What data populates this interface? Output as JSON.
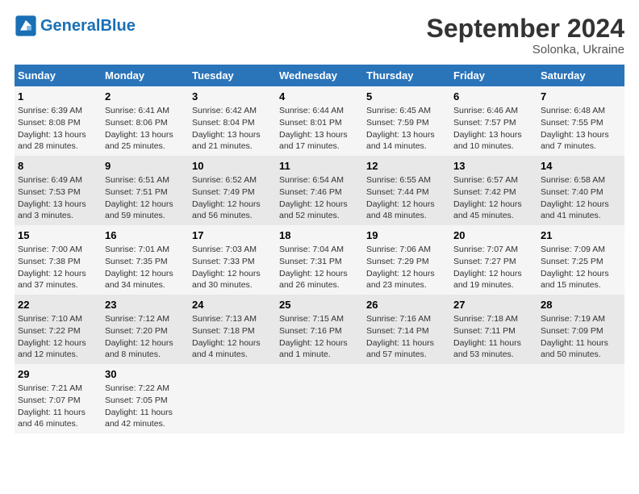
{
  "header": {
    "logo_line1": "General",
    "logo_line2": "Blue",
    "month": "September 2024",
    "location": "Solonka, Ukraine"
  },
  "days_of_week": [
    "Sunday",
    "Monday",
    "Tuesday",
    "Wednesday",
    "Thursday",
    "Friday",
    "Saturday"
  ],
  "weeks": [
    [
      {
        "day": "1",
        "info": "Sunrise: 6:39 AM\nSunset: 8:08 PM\nDaylight: 13 hours\nand 28 minutes."
      },
      {
        "day": "2",
        "info": "Sunrise: 6:41 AM\nSunset: 8:06 PM\nDaylight: 13 hours\nand 25 minutes."
      },
      {
        "day": "3",
        "info": "Sunrise: 6:42 AM\nSunset: 8:04 PM\nDaylight: 13 hours\nand 21 minutes."
      },
      {
        "day": "4",
        "info": "Sunrise: 6:44 AM\nSunset: 8:01 PM\nDaylight: 13 hours\nand 17 minutes."
      },
      {
        "day": "5",
        "info": "Sunrise: 6:45 AM\nSunset: 7:59 PM\nDaylight: 13 hours\nand 14 minutes."
      },
      {
        "day": "6",
        "info": "Sunrise: 6:46 AM\nSunset: 7:57 PM\nDaylight: 13 hours\nand 10 minutes."
      },
      {
        "day": "7",
        "info": "Sunrise: 6:48 AM\nSunset: 7:55 PM\nDaylight: 13 hours\nand 7 minutes."
      }
    ],
    [
      {
        "day": "8",
        "info": "Sunrise: 6:49 AM\nSunset: 7:53 PM\nDaylight: 13 hours\nand 3 minutes."
      },
      {
        "day": "9",
        "info": "Sunrise: 6:51 AM\nSunset: 7:51 PM\nDaylight: 12 hours\nand 59 minutes."
      },
      {
        "day": "10",
        "info": "Sunrise: 6:52 AM\nSunset: 7:49 PM\nDaylight: 12 hours\nand 56 minutes."
      },
      {
        "day": "11",
        "info": "Sunrise: 6:54 AM\nSunset: 7:46 PM\nDaylight: 12 hours\nand 52 minutes."
      },
      {
        "day": "12",
        "info": "Sunrise: 6:55 AM\nSunset: 7:44 PM\nDaylight: 12 hours\nand 48 minutes."
      },
      {
        "day": "13",
        "info": "Sunrise: 6:57 AM\nSunset: 7:42 PM\nDaylight: 12 hours\nand 45 minutes."
      },
      {
        "day": "14",
        "info": "Sunrise: 6:58 AM\nSunset: 7:40 PM\nDaylight: 12 hours\nand 41 minutes."
      }
    ],
    [
      {
        "day": "15",
        "info": "Sunrise: 7:00 AM\nSunset: 7:38 PM\nDaylight: 12 hours\nand 37 minutes."
      },
      {
        "day": "16",
        "info": "Sunrise: 7:01 AM\nSunset: 7:35 PM\nDaylight: 12 hours\nand 34 minutes."
      },
      {
        "day": "17",
        "info": "Sunrise: 7:03 AM\nSunset: 7:33 PM\nDaylight: 12 hours\nand 30 minutes."
      },
      {
        "day": "18",
        "info": "Sunrise: 7:04 AM\nSunset: 7:31 PM\nDaylight: 12 hours\nand 26 minutes."
      },
      {
        "day": "19",
        "info": "Sunrise: 7:06 AM\nSunset: 7:29 PM\nDaylight: 12 hours\nand 23 minutes."
      },
      {
        "day": "20",
        "info": "Sunrise: 7:07 AM\nSunset: 7:27 PM\nDaylight: 12 hours\nand 19 minutes."
      },
      {
        "day": "21",
        "info": "Sunrise: 7:09 AM\nSunset: 7:25 PM\nDaylight: 12 hours\nand 15 minutes."
      }
    ],
    [
      {
        "day": "22",
        "info": "Sunrise: 7:10 AM\nSunset: 7:22 PM\nDaylight: 12 hours\nand 12 minutes."
      },
      {
        "day": "23",
        "info": "Sunrise: 7:12 AM\nSunset: 7:20 PM\nDaylight: 12 hours\nand 8 minutes."
      },
      {
        "day": "24",
        "info": "Sunrise: 7:13 AM\nSunset: 7:18 PM\nDaylight: 12 hours\nand 4 minutes."
      },
      {
        "day": "25",
        "info": "Sunrise: 7:15 AM\nSunset: 7:16 PM\nDaylight: 12 hours\nand 1 minute."
      },
      {
        "day": "26",
        "info": "Sunrise: 7:16 AM\nSunset: 7:14 PM\nDaylight: 11 hours\nand 57 minutes."
      },
      {
        "day": "27",
        "info": "Sunrise: 7:18 AM\nSunset: 7:11 PM\nDaylight: 11 hours\nand 53 minutes."
      },
      {
        "day": "28",
        "info": "Sunrise: 7:19 AM\nSunset: 7:09 PM\nDaylight: 11 hours\nand 50 minutes."
      }
    ],
    [
      {
        "day": "29",
        "info": "Sunrise: 7:21 AM\nSunset: 7:07 PM\nDaylight: 11 hours\nand 46 minutes."
      },
      {
        "day": "30",
        "info": "Sunrise: 7:22 AM\nSunset: 7:05 PM\nDaylight: 11 hours\nand 42 minutes."
      },
      {
        "day": "",
        "info": ""
      },
      {
        "day": "",
        "info": ""
      },
      {
        "day": "",
        "info": ""
      },
      {
        "day": "",
        "info": ""
      },
      {
        "day": "",
        "info": ""
      }
    ]
  ]
}
